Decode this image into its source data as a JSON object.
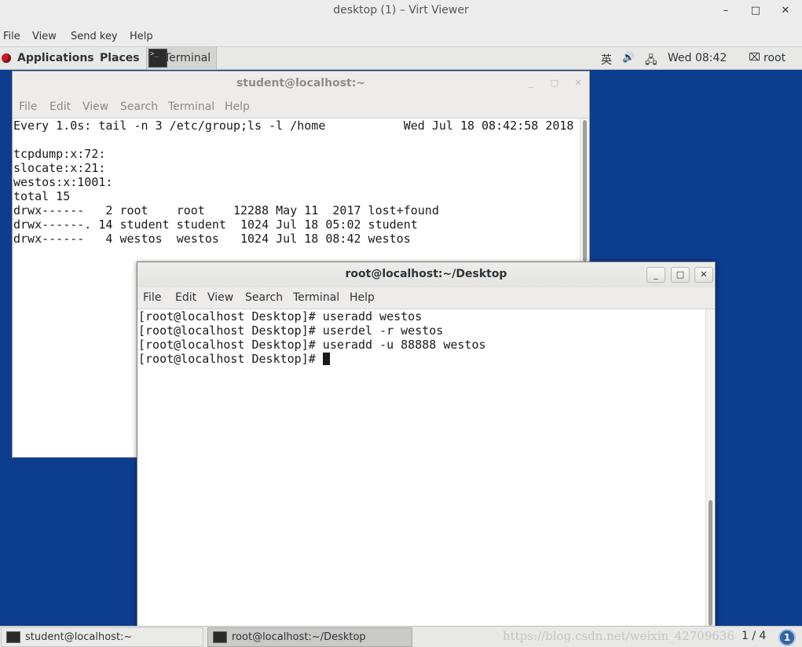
{
  "viewer": {
    "title": "desktop (1) – Virt Viewer",
    "controls": {
      "minimize": "–",
      "maximize": "□",
      "close": "✕"
    },
    "menu": [
      "File",
      "View",
      "Send key",
      "Help"
    ]
  },
  "topbar": {
    "applications": "Applications",
    "places": "Places",
    "terminal_task": "Terminal",
    "input_method": "英",
    "volume_icon": "🔊",
    "network_icon": "🖧",
    "clock": "Wed 08:42",
    "user_icon": "⌧",
    "user": "root"
  },
  "student_window": {
    "title": "student@localhost:~",
    "menu": [
      "File",
      "Edit",
      "View",
      "Search",
      "Terminal",
      "Help"
    ],
    "controls": {
      "minimize": "_",
      "maximize": "□",
      "close": "✕"
    },
    "lines": [
      "Every 1.0s: tail -n 3 /etc/group;ls -l /home           Wed Jul 18 08:42:58 2018",
      "",
      "tcpdump:x:72:",
      "slocate:x:21:",
      "westos:x:1001:",
      "total 15",
      "drwx------   2 root    root    12288 May 11  2017 lost+found",
      "drwx------. 14 student student  1024 Jul 18 05:02 student",
      "drwx------   4 westos  westos   1024 Jul 18 08:42 westos"
    ]
  },
  "root_window": {
    "title": "root@localhost:~/Desktop",
    "menu": [
      "File",
      "Edit",
      "View",
      "Search",
      "Terminal",
      "Help"
    ],
    "controls": {
      "minimize": "_",
      "maximize": "□",
      "close": "✕"
    },
    "lines": [
      "[root@localhost Desktop]# useradd westos",
      "[root@localhost Desktop]# userdel -r westos",
      "[root@localhost Desktop]# useradd -u 88888 westos"
    ],
    "prompt": "[root@localhost Desktop]# "
  },
  "bottombar": {
    "tasks": [
      "student@localhost:~",
      "root@localhost:~/Desktop"
    ],
    "watermark": "https://blog.csdn.net/weixin_42709636",
    "workspace": "1 / 4",
    "notifications": "1"
  }
}
